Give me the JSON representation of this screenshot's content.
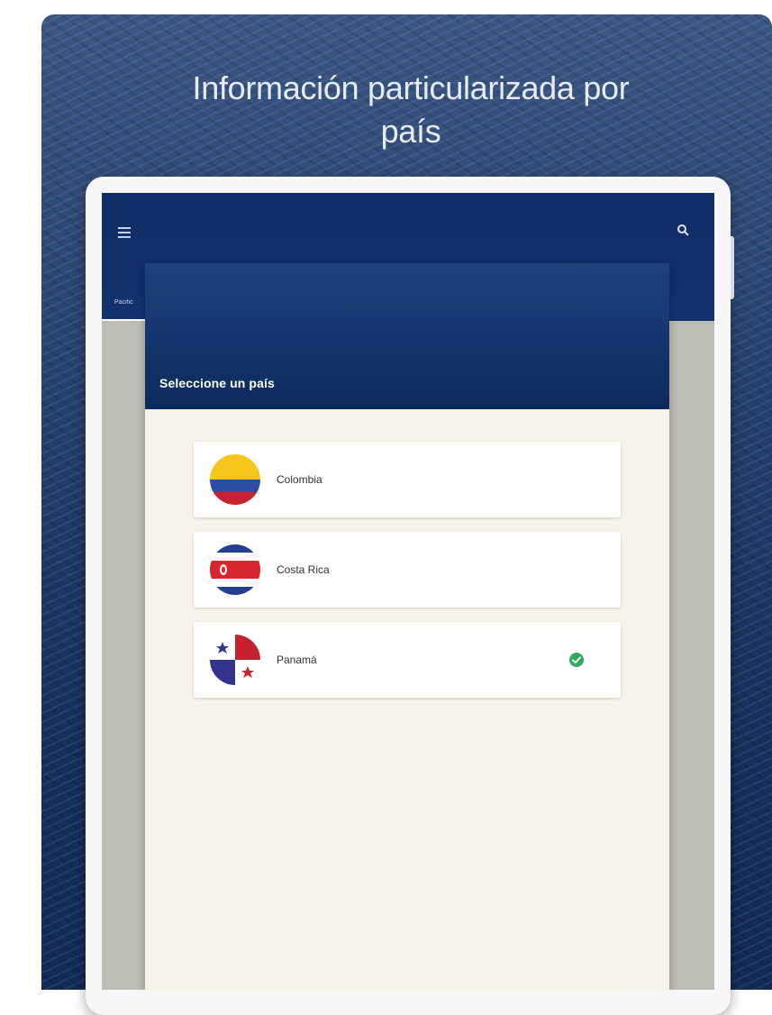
{
  "promo": {
    "headline_line1": "Información particularizada por",
    "headline_line2": "país"
  },
  "app_bar": {
    "menu_icon": "hamburger-menu-icon",
    "search_icon": "search-icon",
    "tab_label_partial": "Pacific"
  },
  "dialog": {
    "title": "Seleccione un país",
    "countries": [
      {
        "name": "Colombia",
        "flag_icon": "colombia-flag-icon",
        "selected": false
      },
      {
        "name": "Costa Rica",
        "flag_icon": "costa-rica-flag-icon",
        "selected": false
      },
      {
        "name": "Panamá",
        "flag_icon": "panama-flag-icon",
        "selected": true
      }
    ]
  },
  "colors": {
    "background_navy": "#172f5c",
    "app_bar": "#0f2d66",
    "dialog_surface": "#f7f3ea",
    "selected_check": "#2eab5c"
  }
}
